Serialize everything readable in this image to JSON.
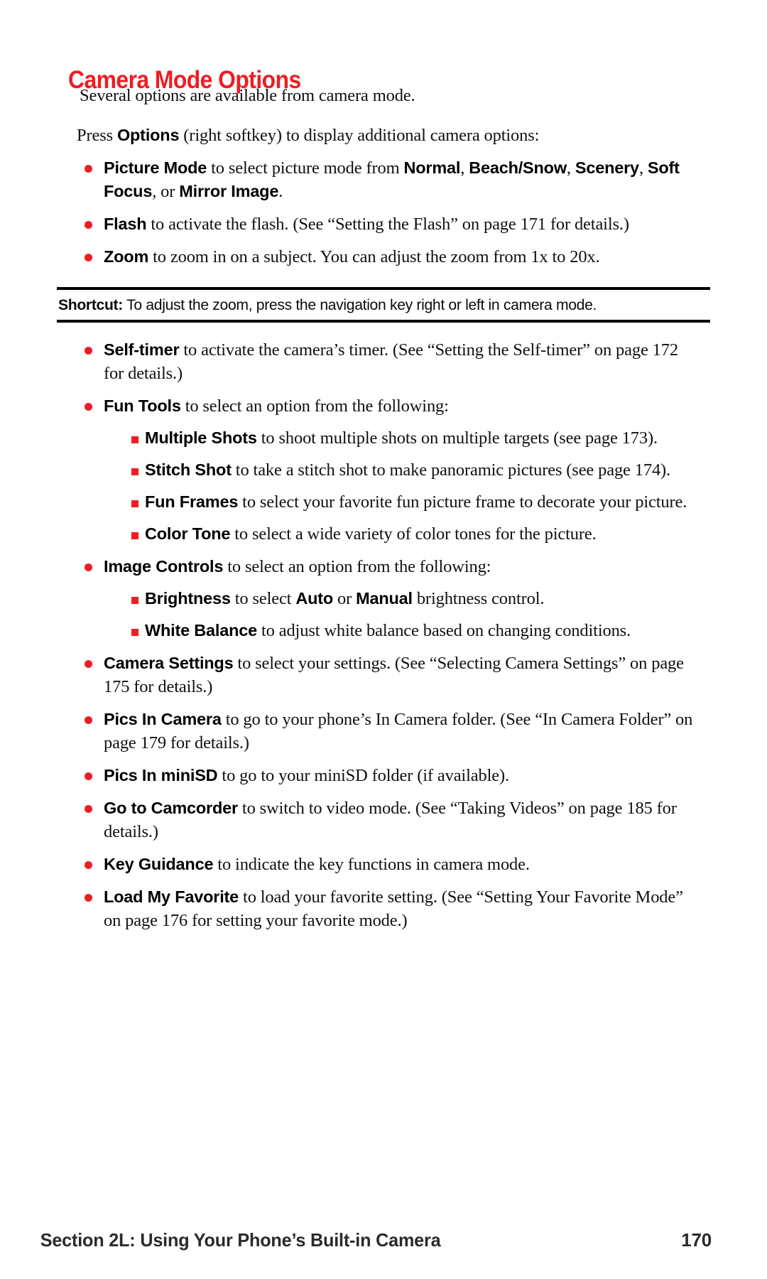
{
  "page": {
    "title": "Camera Mode Options",
    "title_color": "#ee1d23",
    "bullet_color": "#ee1d23",
    "page_number": "170",
    "footer_section": "Section 2L: Using Your Phone’s Built-in Camera"
  },
  "intro": {
    "line1": "Several options are available from camera mode.",
    "line2_pre": "Press ",
    "line2_bold": "Options",
    "line2_post": " (right softkey) to display additional camera options:"
  },
  "bullets": [
    {
      "term": "Picture Mode",
      "text_1": " to select picture mode from ",
      "term_2": "Normal",
      "text_2": ", ",
      "term_3": "Beach/Snow",
      "text_3": ", ",
      "term_4": "Scenery",
      "text_4": ", ",
      "term_5": "Soft Focus",
      "text_5": ", or ",
      "term_6": "Mirror Image",
      "text_6": "."
    },
    {
      "term": "Flash",
      "text": " to activate the flash. (See “Setting the Flash” on page 171 for details.)"
    },
    {
      "term": "Zoom",
      "text": " to zoom in on a subject. You can adjust the zoom from 1x to 20x."
    }
  ],
  "shortcut": {
    "label": "Shortcut:",
    "text": " To adjust the zoom, press the navigation key right or left in camera mode."
  },
  "bullets_after": [
    {
      "term": "Self-timer",
      "text": " to activate the camera’s timer. (See “Setting the Self-timer” on page 172 for details.)"
    },
    {
      "term": "Fun Tools",
      "text": " to select an option from the following:"
    }
  ],
  "fun_tools_sub": [
    {
      "term": "Multiple Shots",
      "text": " to shoot multiple shots on multiple targets (see page 173)."
    },
    {
      "term": "Stitch Shot",
      "text": " to take a stitch shot to make panoramic pictures (see page 174)."
    },
    {
      "term": "Fun Frames",
      "text": " to select your favorite fun picture frame to decorate your picture."
    },
    {
      "term": "Color Tone",
      "text": " to select a wide variety of color tones for the picture."
    }
  ],
  "image_controls": {
    "term": "Image Controls",
    "text": " to select an option from the following:"
  },
  "image_controls_sub": [
    {
      "term": "Brightness",
      "text_1": " to select ",
      "term_2": "Auto",
      "text_2": " or ",
      "term_3": "Manual",
      "text_3": " brightness control."
    },
    {
      "term": "White Balance",
      "text": " to adjust white balance based on changing conditions."
    }
  ],
  "bullets_tail": [
    {
      "term": "Camera Settings",
      "text": " to select your settings. (See “Selecting Camera Settings” on page 175 for details.)"
    },
    {
      "term": "Pics In Camera",
      "text": " to go to your phone’s In Camera folder. (See “In Camera Folder” on page 179 for details.)"
    },
    {
      "term": "Pics In miniSD",
      "text": " to go to your miniSD folder (if available)."
    },
    {
      "term": "Go to Camcorder",
      "text": " to switch to video mode. (See “Taking Videos” on page 185 for details.)"
    },
    {
      "term": "Key Guidance",
      "text": " to indicate the key functions in camera mode."
    },
    {
      "term": "Load My Favorite",
      "text": " to load your favorite setting. (See “Setting Your Favorite Mode” on page 176 for setting your favorite mode.)"
    }
  ]
}
